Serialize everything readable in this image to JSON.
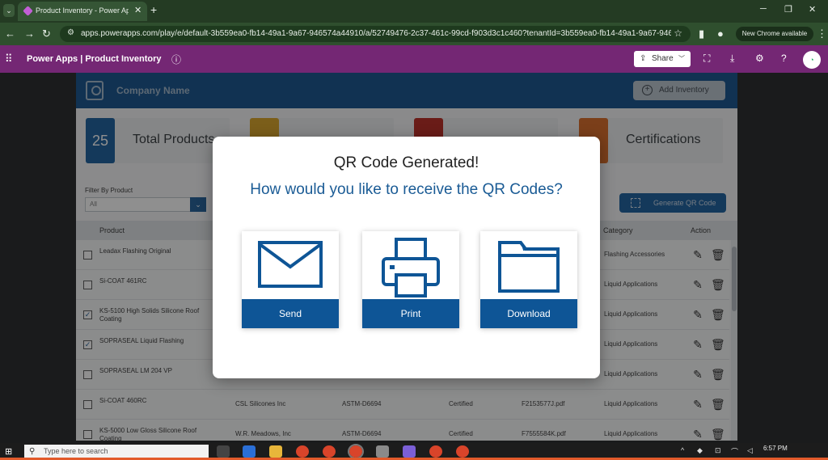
{
  "browser": {
    "tab_title": "Product Inventory - Power Apps",
    "url": "apps.powerapps.com/play/e/default-3b559ea0-fb14-49a1-9a67-946574a44910/a/52749476-2c37-461c-99cd-f903d3c1c460?tenantId=3b559ea0-fb14-49a1-9a67-946574a449...",
    "new_chrome_label": "New Chrome available"
  },
  "powerapps": {
    "title": "Power Apps  |  Product Inventory",
    "share_label": "Share"
  },
  "app": {
    "company_name": "Company Name",
    "add_inventory_label": "Add Inventory",
    "stats": [
      {
        "value": "25",
        "label": "Total Products",
        "color": "#155a9c"
      },
      {
        "value": "",
        "label": "",
        "color": "#d9a21f"
      },
      {
        "value": "",
        "label": "",
        "color": "#b8231c"
      },
      {
        "value": "",
        "label": "Certifications",
        "color": "#d9661f"
      }
    ],
    "filter_label": "Filter By Product",
    "filter_value": "All",
    "generate_label": "Generate QR Code",
    "columns": {
      "product": "Product",
      "category": "Category",
      "action": "Action"
    },
    "rows": [
      {
        "checked": false,
        "product": "Leadax Flashing Original",
        "supplier": "",
        "standard": "",
        "status": "",
        "file": "",
        "category": "Flashing Accessories"
      },
      {
        "checked": false,
        "product": "Si-COAT 461RC",
        "supplier": "",
        "standard": "",
        "status": "",
        "file": "",
        "category": "Liquid Applications"
      },
      {
        "checked": true,
        "product": "KS-5100 High Solids Silicone Roof Coating",
        "supplier": "",
        "standard": "",
        "status": "",
        "file": "",
        "category": "Liquid Applications"
      },
      {
        "checked": true,
        "product": "SOPRASEAL Liquid Flashing",
        "supplier": "",
        "standard": "",
        "status": "",
        "file": "",
        "category": "Liquid Applications"
      },
      {
        "checked": false,
        "product": "SOPRASEAL LM 204 VP",
        "supplier": "",
        "standard": "",
        "status": "",
        "file": "",
        "category": "Liquid Applications"
      },
      {
        "checked": false,
        "product": "Si-COAT 460RC",
        "supplier": "CSL Silicones Inc",
        "standard": "ASTM-D6694",
        "status": "Certified",
        "file": "F2153577J.pdf",
        "category": "Liquid Applications"
      },
      {
        "checked": false,
        "product": "KS-5000 Low Gloss Silicone Roof Coating",
        "supplier": "W.R. Meadows, Inc",
        "standard": "ASTM-D6694",
        "status": "Certified",
        "file": "F7555584K.pdf",
        "category": "Liquid Applications"
      }
    ]
  },
  "modal": {
    "title": "QR Code Generated!",
    "subtitle": "How would you like to receive the QR Codes?",
    "options": [
      {
        "label": "Send",
        "icon": "envelope-icon"
      },
      {
        "label": "Print",
        "icon": "printer-icon"
      },
      {
        "label": "Download",
        "icon": "folder-icon"
      }
    ]
  },
  "taskbar": {
    "search_placeholder": "Type here to search",
    "time": "6:57 PM"
  },
  "colors": {
    "powerapps_purple": "#742774",
    "app_blue": "#0e4d8a",
    "button_blue": "#0e5596",
    "subtitle_blue": "#1a5b95"
  }
}
